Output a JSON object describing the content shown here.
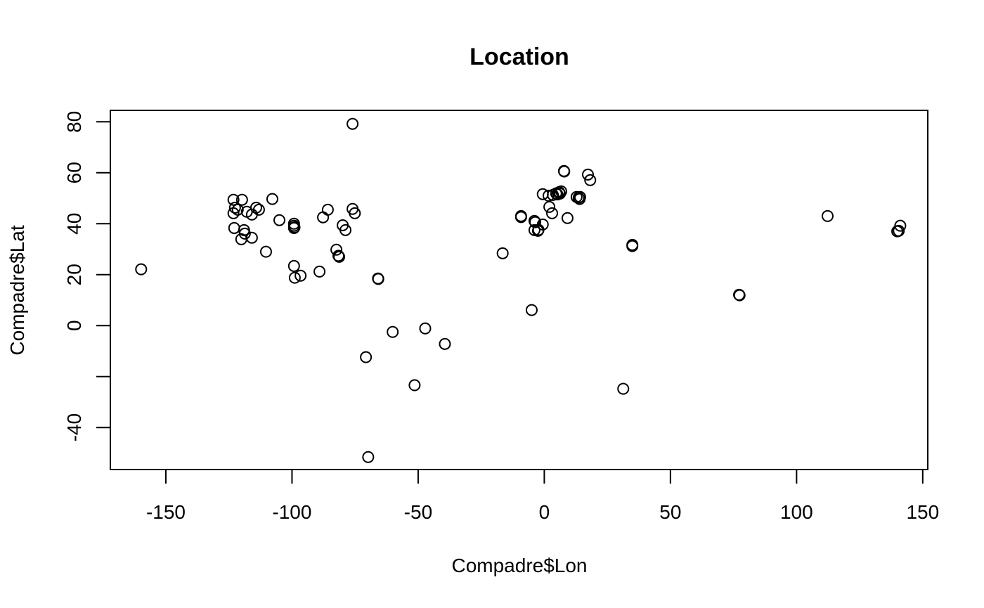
{
  "chart_data": {
    "type": "scatter",
    "title": "Location",
    "xlabel": "Compadre$Lon",
    "ylabel": "Compadre$Lat",
    "xlim": [
      -172,
      152
    ],
    "ylim": [
      -56.5,
      84.5
    ],
    "xticks": [
      -150,
      -100,
      -50,
      0,
      50,
      100,
      150
    ],
    "xtick_labels": [
      "-150",
      "-100",
      "-50",
      "0",
      "50",
      "100",
      "150"
    ],
    "yticks": [
      -40,
      -20,
      0,
      20,
      40,
      60,
      80
    ],
    "ytick_labels": [
      "-40",
      "",
      "0",
      "20",
      "40",
      "60",
      "80"
    ],
    "grid": false,
    "legend": "none",
    "marker": "open-circle",
    "color": "#000000",
    "points": [
      {
        "x": -159.8,
        "y": 22.1
      },
      {
        "x": -123.2,
        "y": 49.4
      },
      {
        "x": -119.8,
        "y": 49.4
      },
      {
        "x": -107.8,
        "y": 49.7
      },
      {
        "x": -122.6,
        "y": 46.3
      },
      {
        "x": -121.5,
        "y": 45.5
      },
      {
        "x": -123.2,
        "y": 44.1
      },
      {
        "x": -117.9,
        "y": 44.7
      },
      {
        "x": -115.9,
        "y": 43.6
      },
      {
        "x": -114.2,
        "y": 46.3
      },
      {
        "x": -113.1,
        "y": 45.5
      },
      {
        "x": -105.0,
        "y": 41.4
      },
      {
        "x": -122.9,
        "y": 38.3
      },
      {
        "x": -119.0,
        "y": 37.5
      },
      {
        "x": -118.7,
        "y": 36.1
      },
      {
        "x": -120.1,
        "y": 33.9
      },
      {
        "x": -115.9,
        "y": 34.5
      },
      {
        "x": -110.3,
        "y": 29.0
      },
      {
        "x": -99.2,
        "y": 40.0
      },
      {
        "x": -99.2,
        "y": 39.2
      },
      {
        "x": -99.0,
        "y": 38.6
      },
      {
        "x": -99.2,
        "y": 38.3
      },
      {
        "x": -85.8,
        "y": 45.5
      },
      {
        "x": -87.7,
        "y": 42.5
      },
      {
        "x": -76.0,
        "y": 45.8
      },
      {
        "x": -75.1,
        "y": 44.1
      },
      {
        "x": -79.9,
        "y": 39.4
      },
      {
        "x": -78.8,
        "y": 37.5
      },
      {
        "x": -82.4,
        "y": 29.8
      },
      {
        "x": -81.3,
        "y": 27.0
      },
      {
        "x": -81.6,
        "y": 27.4
      },
      {
        "x": -76.0,
        "y": 79.2
      },
      {
        "x": -99.2,
        "y": 23.4
      },
      {
        "x": -98.9,
        "y": 18.8
      },
      {
        "x": -96.6,
        "y": 19.6
      },
      {
        "x": -89.1,
        "y": 21.2
      },
      {
        "x": -65.9,
        "y": 18.5
      },
      {
        "x": -65.8,
        "y": 18.3
      },
      {
        "x": -60.1,
        "y": -2.5
      },
      {
        "x": -47.2,
        "y": -1.1
      },
      {
        "x": -39.4,
        "y": -7.2
      },
      {
        "x": -70.7,
        "y": -12.4
      },
      {
        "x": -51.4,
        "y": -23.4
      },
      {
        "x": -69.8,
        "y": -51.6
      },
      {
        "x": -16.5,
        "y": 28.4
      },
      {
        "x": -5.0,
        "y": 6.1
      },
      {
        "x": -9.2,
        "y": 43.0
      },
      {
        "x": -9.2,
        "y": 42.6
      },
      {
        "x": -3.9,
        "y": 41.1
      },
      {
        "x": -3.6,
        "y": 40.6
      },
      {
        "x": -0.6,
        "y": 39.7
      },
      {
        "x": -3.9,
        "y": 37.5
      },
      {
        "x": -2.5,
        "y": 37.2
      },
      {
        "x": -2.3,
        "y": 37.6
      },
      {
        "x": 2.0,
        "y": 46.6
      },
      {
        "x": 3.1,
        "y": 44.1
      },
      {
        "x": -0.6,
        "y": 51.6
      },
      {
        "x": 1.7,
        "y": 51.0
      },
      {
        "x": 3.4,
        "y": 51.3
      },
      {
        "x": 4.7,
        "y": 51.9
      },
      {
        "x": 5.2,
        "y": 51.5
      },
      {
        "x": 5.9,
        "y": 52.4
      },
      {
        "x": 6.2,
        "y": 51.8
      },
      {
        "x": 6.7,
        "y": 52.7
      },
      {
        "x": 7.8,
        "y": 60.7
      },
      {
        "x": 7.9,
        "y": 60.5
      },
      {
        "x": 17.3,
        "y": 59.3
      },
      {
        "x": 18.2,
        "y": 57.1
      },
      {
        "x": 12.8,
        "y": 50.5
      },
      {
        "x": 14.2,
        "y": 50.5
      },
      {
        "x": 14.0,
        "y": 49.7
      },
      {
        "x": 13.6,
        "y": 50.2
      },
      {
        "x": 9.2,
        "y": 42.2
      },
      {
        "x": 34.9,
        "y": 31.7
      },
      {
        "x": 34.9,
        "y": 31.2
      },
      {
        "x": 31.3,
        "y": -24.8
      },
      {
        "x": 77.4,
        "y": 11.9
      },
      {
        "x": 77.2,
        "y": 12.1
      },
      {
        "x": 112.3,
        "y": 43.0
      },
      {
        "x": 141.1,
        "y": 39.2
      },
      {
        "x": 139.9,
        "y": 37.0
      },
      {
        "x": 140.5,
        "y": 37.2
      }
    ]
  }
}
